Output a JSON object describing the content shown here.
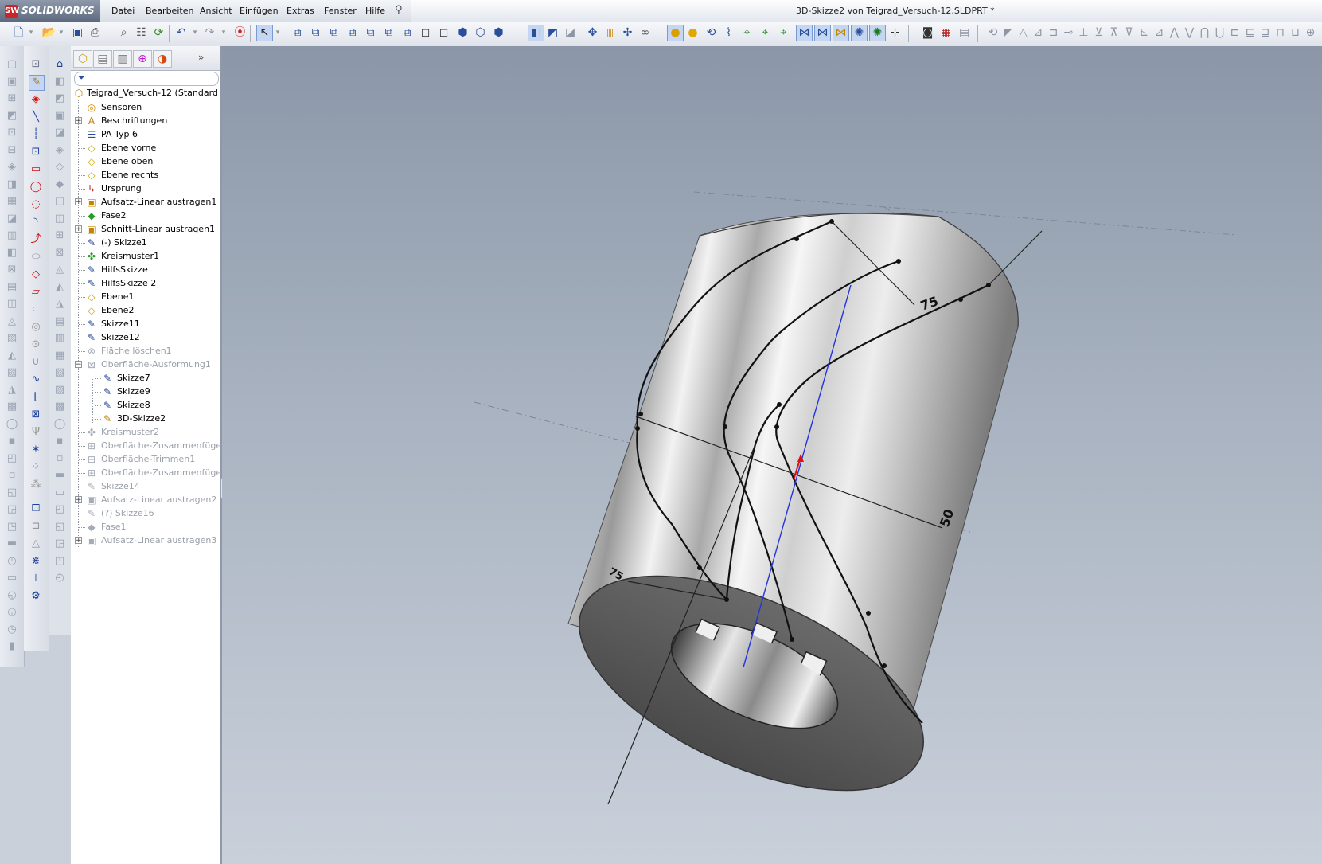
{
  "app": {
    "logo_text": "SOLIDWORKS",
    "logo_mark": "SW",
    "document_title": "3D-Skizze2 von Teigrad_Versuch-12.SLDPRT *"
  },
  "menu": [
    "Datei",
    "Bearbeiten",
    "Ansicht",
    "Einfügen",
    "Extras",
    "Fenster",
    "Hilfe"
  ],
  "toolbar": {
    "icons": [
      "new-document-icon",
      "dropdown-icon",
      "open-icon",
      "dropdown-icon",
      "save-icon",
      "print-icon",
      "print-preview-icon",
      "options-icon",
      "rebuild-icon",
      "undo-icon",
      "dropdown-icon",
      "redo-icon",
      "dropdown-icon",
      "traffic-light-icon",
      "select-icon",
      "dropdown-icon",
      "view-front-icon",
      "view-back-icon",
      "view-left-icon",
      "view-right-icon",
      "view-top-icon",
      "view-bottom-icon",
      "view-iso-icon",
      "view-trimetric-icon",
      "view-dimetric-icon",
      "shaded-icon",
      "wireframe-icon",
      "hidden-lines-icon",
      "section-view-icon",
      "zoom-icon",
      "zoom-fit-icon",
      "pan-icon",
      "rotate-icon",
      "appearance-icon",
      "realview-icon",
      "refresh-icon",
      "sketch-icon",
      "smart-dimension-icon",
      "relations-icon",
      "display-relations-icon",
      "plane-icon",
      "spline-icon",
      "3d-sketch-icon",
      "point-icon",
      "axis-icon",
      "origin-icon",
      "camera-icon",
      "render-icon",
      "display-states-icon"
    ],
    "right_gray_icons": 22
  },
  "feature_tree": {
    "root": "Teigrad_Versuch-12  (Standard",
    "items": [
      {
        "label": "Sensoren",
        "icon": "sensor-icon",
        "indent": 1,
        "expand": false,
        "dim": false
      },
      {
        "label": "Beschriftungen",
        "icon": "annotations-icon",
        "indent": 1,
        "expand": true,
        "dim": false
      },
      {
        "label": "PA Typ 6",
        "icon": "material-icon",
        "indent": 1,
        "expand": false,
        "dim": false
      },
      {
        "label": "Ebene vorne",
        "icon": "plane-icon",
        "indent": 1,
        "expand": false,
        "dim": false
      },
      {
        "label": "Ebene oben",
        "icon": "plane-icon",
        "indent": 1,
        "expand": false,
        "dim": false
      },
      {
        "label": "Ebene rechts",
        "icon": "plane-icon",
        "indent": 1,
        "expand": false,
        "dim": false
      },
      {
        "label": "Ursprung",
        "icon": "origin-icon",
        "indent": 1,
        "expand": false,
        "dim": false
      },
      {
        "label": "Aufsatz-Linear austragen1",
        "icon": "extrude-boss-icon",
        "indent": 1,
        "expand": true,
        "dim": false
      },
      {
        "label": "Fase2",
        "icon": "chamfer-icon",
        "indent": 1,
        "expand": false,
        "dim": false
      },
      {
        "label": "Schnitt-Linear austragen1",
        "icon": "extrude-cut-icon",
        "indent": 1,
        "expand": true,
        "dim": false
      },
      {
        "label": "(-) Skizze1",
        "icon": "sketch-icon",
        "indent": 1,
        "expand": false,
        "dim": false
      },
      {
        "label": "Kreismuster1",
        "icon": "circular-pattern-icon",
        "indent": 1,
        "expand": false,
        "dim": false
      },
      {
        "label": "HilfsSkizze",
        "icon": "sketch-icon",
        "indent": 1,
        "expand": false,
        "dim": false
      },
      {
        "label": "HilfsSkizze 2",
        "icon": "sketch-icon",
        "indent": 1,
        "expand": false,
        "dim": false
      },
      {
        "label": "Ebene1",
        "icon": "plane-icon",
        "indent": 1,
        "expand": false,
        "dim": false
      },
      {
        "label": "Ebene2",
        "icon": "plane-icon",
        "indent": 1,
        "expand": false,
        "dim": false
      },
      {
        "label": "Skizze11",
        "icon": "sketch-icon",
        "indent": 1,
        "expand": false,
        "dim": false
      },
      {
        "label": "Skizze12",
        "icon": "sketch-icon",
        "indent": 1,
        "expand": false,
        "dim": false
      },
      {
        "label": "Fläche löschen1",
        "icon": "delete-face-icon",
        "indent": 1,
        "expand": false,
        "dim": true
      },
      {
        "label": "Oberfläche-Ausformung1",
        "icon": "surface-loft-icon",
        "indent": 1,
        "expand": "minus",
        "dim": true
      },
      {
        "label": "Skizze7",
        "icon": "sketch-icon",
        "indent": 2,
        "expand": false,
        "dim": false
      },
      {
        "label": "Skizze9",
        "icon": "sketch-icon",
        "indent": 2,
        "expand": false,
        "dim": false
      },
      {
        "label": "Skizze8",
        "icon": "sketch-icon",
        "indent": 2,
        "expand": false,
        "dim": false
      },
      {
        "label": "3D-Skizze2",
        "icon": "3d-sketch-icon",
        "indent": 2,
        "expand": false,
        "dim": false
      },
      {
        "label": "Kreismuster2",
        "icon": "circular-pattern-icon",
        "indent": 1,
        "expand": false,
        "dim": true
      },
      {
        "label": "Oberfläche-Zusammenfüge",
        "icon": "surface-knit-icon",
        "indent": 1,
        "expand": false,
        "dim": true
      },
      {
        "label": "Oberfläche-Trimmen1",
        "icon": "surface-trim-icon",
        "indent": 1,
        "expand": false,
        "dim": true
      },
      {
        "label": "Oberfläche-Zusammenfüge",
        "icon": "surface-knit-icon",
        "indent": 1,
        "expand": false,
        "dim": true
      },
      {
        "label": "Skizze14",
        "icon": "sketch-icon",
        "indent": 1,
        "expand": false,
        "dim": true
      },
      {
        "label": "Aufsatz-Linear austragen2",
        "icon": "extrude-boss-icon",
        "indent": 1,
        "expand": true,
        "dim": true
      },
      {
        "label": "(?) Skizze16",
        "icon": "sketch-icon",
        "indent": 1,
        "expand": false,
        "dim": true
      },
      {
        "label": "Fase1",
        "icon": "chamfer-icon",
        "indent": 1,
        "expand": false,
        "dim": true
      },
      {
        "label": "Aufsatz-Linear austragen3",
        "icon": "extrude-boss-icon",
        "indent": 1,
        "expand": true,
        "dim": true
      }
    ]
  },
  "viewport": {
    "dimension_labels": [
      "75",
      "50",
      "75"
    ]
  },
  "colors": {
    "accent": "#2a4f9a",
    "selection": "#c4d6f1",
    "sketch_line": "#111111",
    "axis_line": "#2233dd",
    "origin": "#e01010"
  }
}
